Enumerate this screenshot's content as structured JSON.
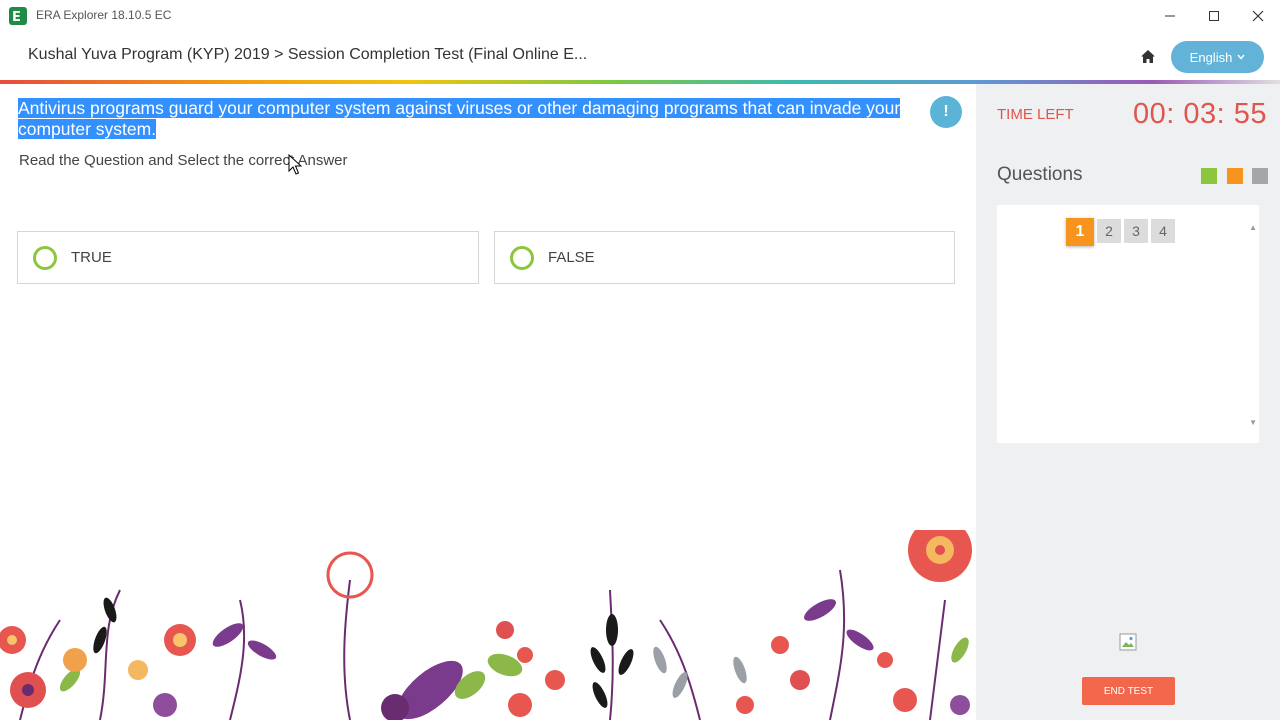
{
  "window": {
    "title": "ERA Explorer 18.10.5 EC"
  },
  "header": {
    "breadcrumb": "Kushal Yuva Program (KYP) 2019 > Session Completion Test (Final Online E...",
    "language": "English"
  },
  "question": {
    "text": "Antivirus programs guard your computer system against viruses or other damaging programs that can invade your computer system.",
    "info_badge": "!",
    "instruction": "Read the Question and Select the correct Answer",
    "options": [
      {
        "label": "TRUE"
      },
      {
        "label": "FALSE"
      }
    ]
  },
  "side_panel": {
    "time_label": "TIME LEFT",
    "time_value": "00: 03: 55",
    "questions_title": "Questions",
    "legend_colors": [
      "#8cc63f",
      "#f7941d",
      "#a6a6a6"
    ],
    "question_numbers": [
      "1",
      "2",
      "3",
      "4"
    ],
    "active_question": "1",
    "end_button": "END TEST"
  },
  "colors": {
    "accent_blue": "#63b3d8",
    "timer_red": "#e0554d",
    "option_green": "#8cc63f",
    "active_orange": "#f7941d",
    "end_button": "#f2674b",
    "selection": "#3390ff"
  }
}
